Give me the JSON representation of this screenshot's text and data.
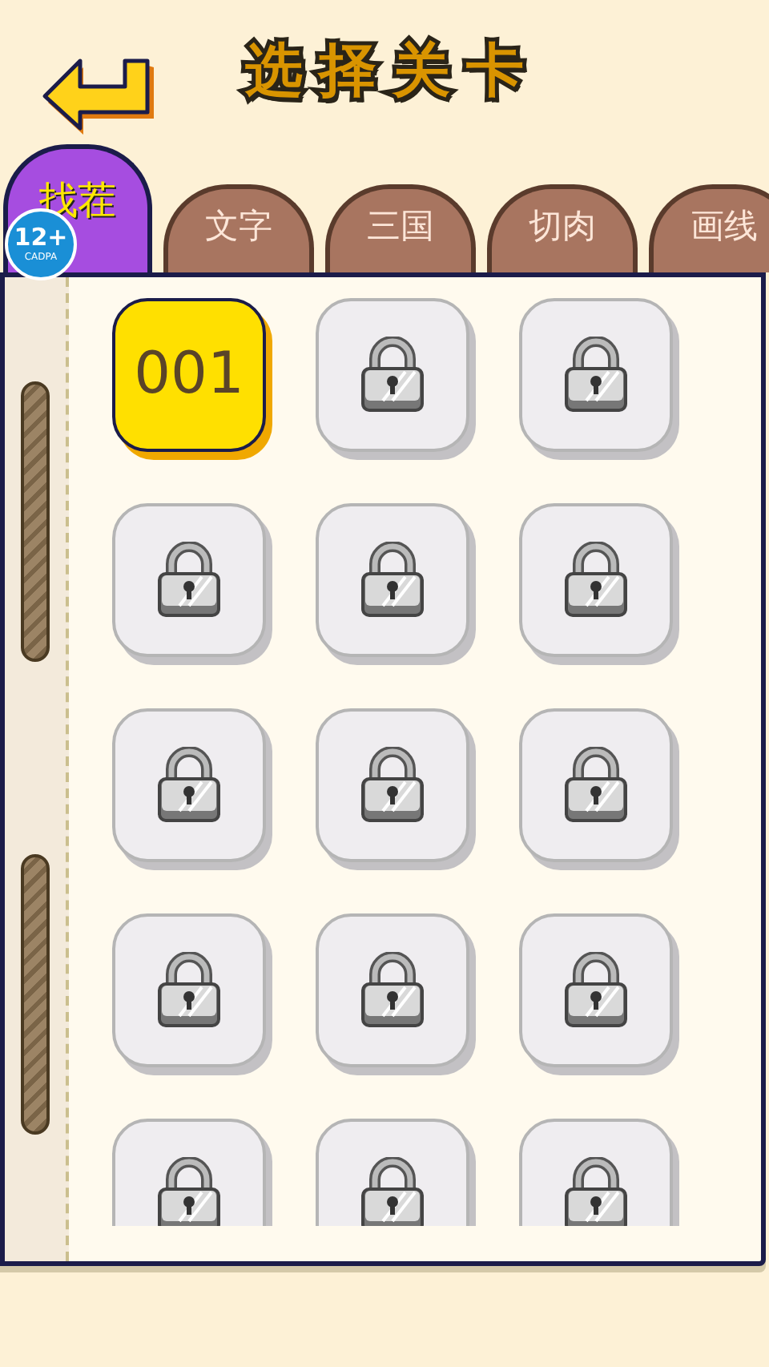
{
  "header": {
    "title": "选择关卡"
  },
  "tabs": [
    {
      "label": "找茬",
      "selected": true
    },
    {
      "label": "文字",
      "selected": false
    },
    {
      "label": "三国",
      "selected": false
    },
    {
      "label": "切肉",
      "selected": false
    },
    {
      "label": "画线",
      "selected": false
    }
  ],
  "age_badge": {
    "rating": "12+",
    "org": "CADPA"
  },
  "levels": [
    {
      "label": "001",
      "locked": false
    },
    {
      "locked": true
    },
    {
      "locked": true
    },
    {
      "locked": true
    },
    {
      "locked": true
    },
    {
      "locked": true
    },
    {
      "locked": true
    },
    {
      "locked": true
    },
    {
      "locked": true
    },
    {
      "locked": true
    },
    {
      "locked": true
    },
    {
      "locked": true
    },
    {
      "locked": true
    },
    {
      "locked": true
    },
    {
      "locked": true
    }
  ]
}
